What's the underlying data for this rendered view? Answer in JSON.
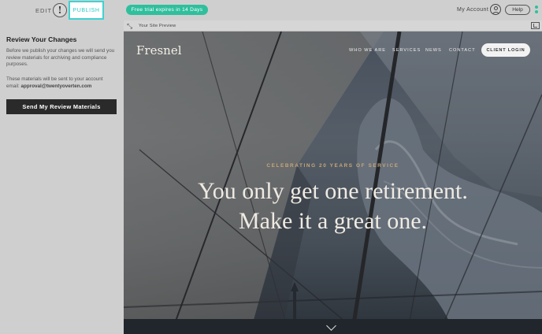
{
  "topbar": {
    "edit_label": "EDIT",
    "alert_symbol": "!",
    "publish_label": "PUBLISH",
    "trial_text": "Free trial expires in 14 Days",
    "account_label": "My Account",
    "help_label": "Help"
  },
  "panel": {
    "title": "Review Your Changes",
    "intro": "Before we publish your changes we will send you review materials for archiving and compliance purposes.",
    "sent_to_prefix": "These materials will be sent to your account email: ",
    "email": "approval@twentyoverten.com",
    "button_label": "Send My Review Materials"
  },
  "preview": {
    "label": "Your Site Preview"
  },
  "site": {
    "logo": "Fresnel",
    "nav": [
      "WHO WE ARE",
      "SERVICES",
      "NEWS",
      "CONTACT"
    ],
    "client_login": "CLIENT LOGIN",
    "tagline": "CELEBRATING 20 YEARS OF SERVICE",
    "headline_line1": "You only get one retirement.",
    "headline_line2": "Make it a great one."
  },
  "colors": {
    "publish_accent": "#3fd2d2",
    "trial_badge": "#2fbf9c",
    "tagline_gold": "#c6a77a",
    "panel_button": "#2a2a2a"
  }
}
